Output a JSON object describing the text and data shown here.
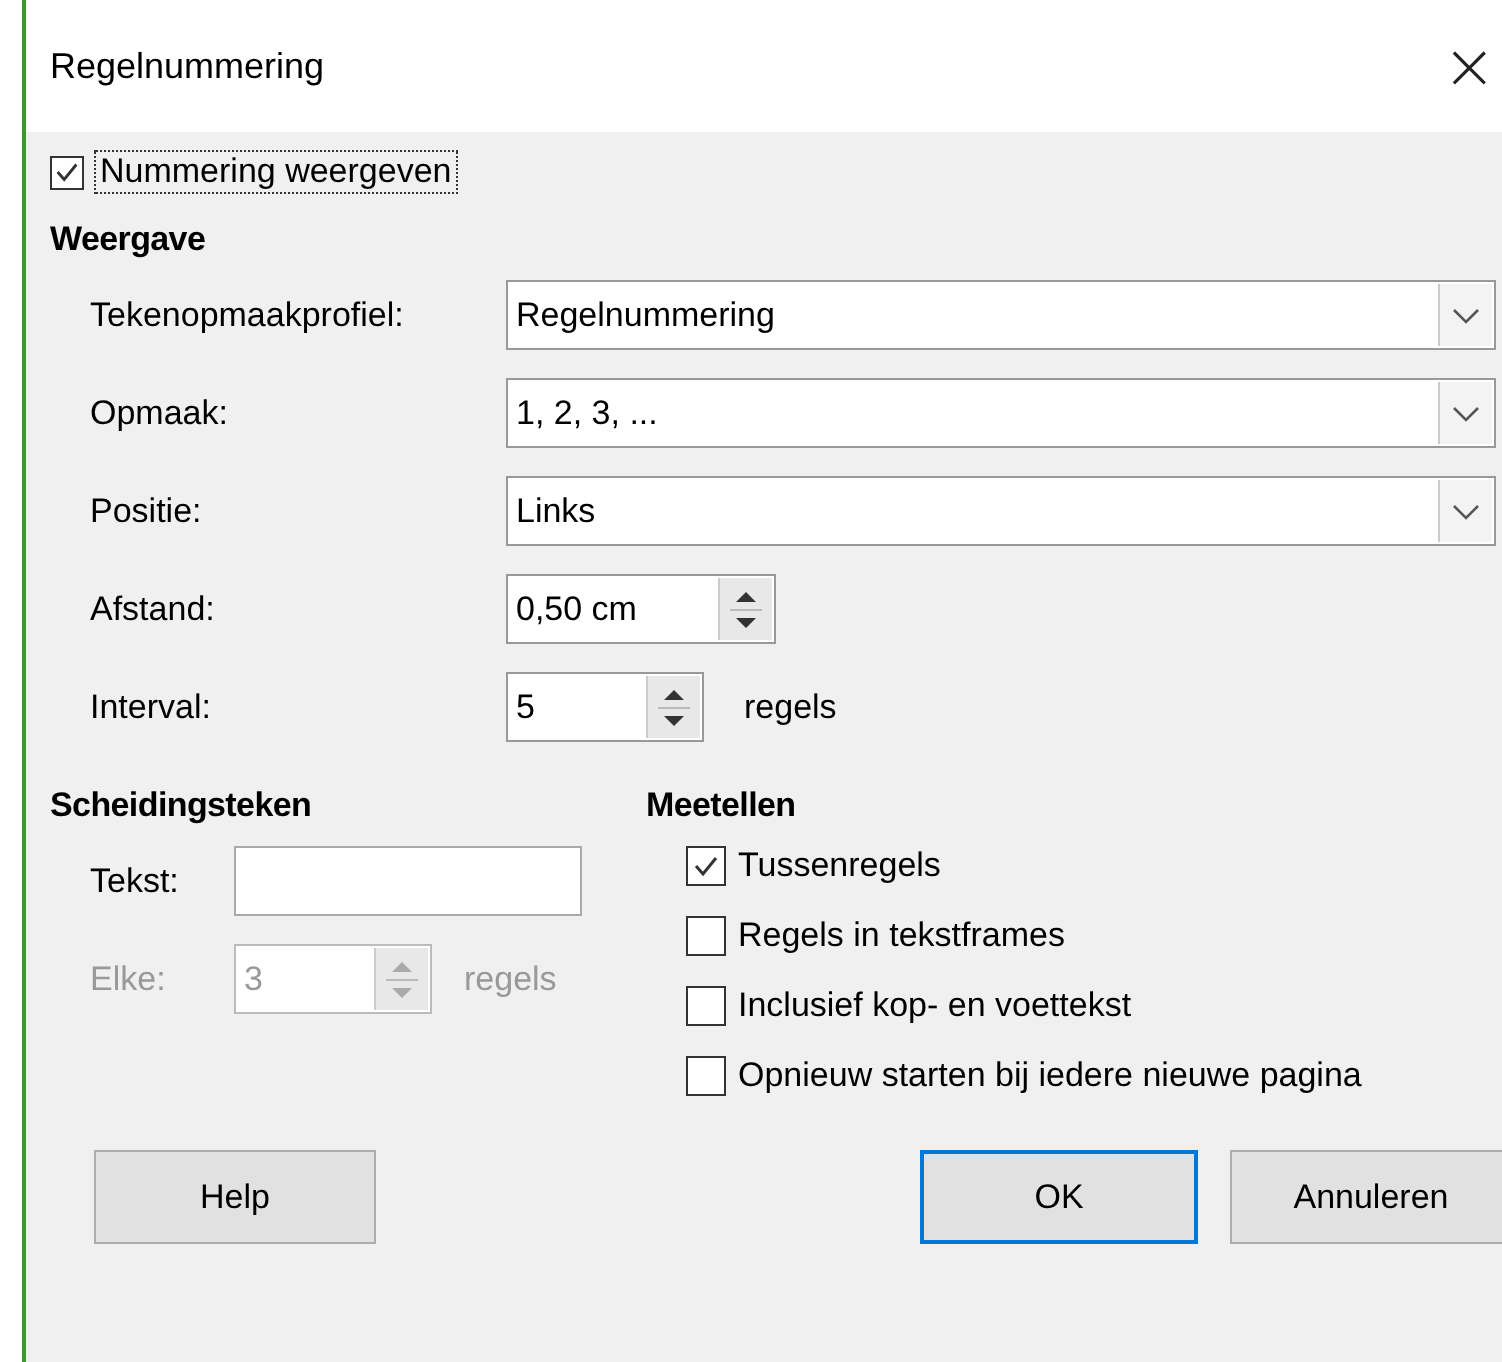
{
  "window": {
    "title": "Regelnummering",
    "close": "×"
  },
  "show_numbering": {
    "label": "Nummering weergeven",
    "checked": true
  },
  "display": {
    "heading": "Weergave",
    "rows": [
      {
        "kind": "dropdown",
        "label": "Tekenopmaakprofiel:",
        "value": "Regelnummering"
      },
      {
        "kind": "dropdown",
        "label": "Opmaak:",
        "value": "1, 2, 3, ..."
      },
      {
        "kind": "dropdown",
        "label": "Positie:",
        "value": "Links"
      },
      {
        "kind": "spin",
        "label": "Afstand:",
        "value": "0,50 cm"
      },
      {
        "kind": "spin",
        "label": "Interval:",
        "value": "5",
        "unit": "regels"
      }
    ]
  },
  "separator": {
    "heading": "Scheidingsteken",
    "rows": [
      {
        "kind": "text",
        "label": "Tekst:",
        "value": "",
        "disabled": false
      },
      {
        "kind": "spin",
        "label": "Elke:",
        "value": "3",
        "unit": "regels",
        "disabled": true
      }
    ]
  },
  "count": {
    "heading": "Meetellen",
    "options": [
      {
        "label": "Tussenregels",
        "checked": true
      },
      {
        "label": "Regels in tekstframes",
        "checked": false
      },
      {
        "label": "Inclusief kop- en voettekst",
        "checked": false
      },
      {
        "label": "Opnieuw starten bij iedere nieuwe pagina",
        "checked": false
      }
    ]
  },
  "buttons": [
    {
      "label": "Help",
      "default": false
    },
    {
      "label": "OK",
      "default": true
    },
    {
      "label": "Annuleren",
      "default": false
    }
  ]
}
